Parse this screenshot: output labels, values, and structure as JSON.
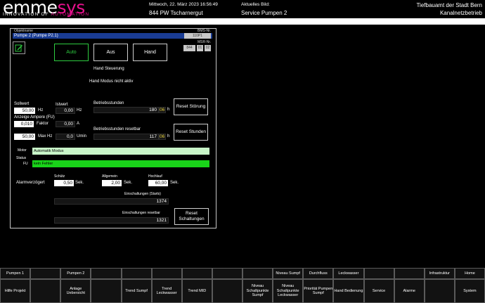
{
  "header": {
    "logo_main_black": "emme",
    "logo_main_pink": "sys",
    "logo_sub_a": "INNOVATION OF ",
    "logo_sub_b": "AUTOMATION",
    "datetime": "Mittwoch, 22. März 2023 16:56:49",
    "station": "844 PW Tscharnergut",
    "current_view_label": "Aktuelles Bild:",
    "current_view": "Service Pumpen 2",
    "org_line1": "Tiefbauamt der Stadt Bern",
    "org_line2": "Kanalnetzbetrieb"
  },
  "panel": {
    "obj_label": "Objektname",
    "obj_name": "Pumpe 2 (Pumpe P2.1)",
    "obj_id_label": "BMS-Nr.",
    "obj_id": "110P1",
    "msr_label": "MSR-Nr.",
    "msr_values": [
      "844",
      "01",
      "02"
    ],
    "modes": {
      "auto": "Auto",
      "aus": "Aus",
      "hand": "Hand"
    },
    "hand_steuerung": "Hand Steuerung",
    "hand_modus": "Hand Modus nicht aktiv",
    "sollwert_label": "Sollwert",
    "sollwert_value": "50,00",
    "sollwert_unit": "Hz",
    "istwert_label": "Istwert",
    "istwert_value": "0,00",
    "istwert_unit": "Hz",
    "ampere_label": "Anzeige Ampere (FU)",
    "faktor_value": "0,010",
    "faktor_label": "Faktor",
    "ampere_value": "0,00",
    "ampere_unit": "A",
    "maxhz_value": "50,00",
    "maxhz_label": "Max Hz",
    "umin_value": "0,0",
    "umin_unit": "Umin",
    "betriebsstunden_label": "Betriebsstunden",
    "betriebsstunden_value": "180",
    "betriebsstunden_min": "06",
    "betriebsstunden_unit": "h",
    "reset_stoerung": "Reset Störung",
    "betriebsstunden_reset_label": "Betriebsstunden resetbar",
    "betriebsstunden_reset_value": "117",
    "betriebsstunden_reset_min": "06",
    "reset_stunden": "Reset Stunden",
    "motor_label": "Motor",
    "motor_value": "Automatik Modus",
    "status_label": "Status",
    "fu_label": "FU",
    "fu_value": "kein Fehler",
    "alarm_label": "Alarmverzögert",
    "schuetz_label": "Schütz",
    "schuetz_value": "0,50",
    "schuetz_unit": "Sek.",
    "allgemein_label": "Allgemein",
    "allgemein_value": "2,00",
    "allgemein_unit": "Sek.",
    "hochlauf_label": "Hochlauf",
    "hochlauf_value": "60,00",
    "hochlauf_unit": "Sek.",
    "starts_label": "Einschaltungen (Starts)",
    "starts_value": "1374",
    "starts_reset_label": "Einschaltungen resetbar",
    "starts_reset_value": "1321",
    "reset_schaltungen": "Reset Schaltungen"
  },
  "footer": {
    "row1": [
      "Pumpen 1",
      "",
      "Pumpen 2",
      "",
      "",
      "",
      "",
      "",
      "",
      "Niveau Sumpf",
      "Durchfluss",
      "Leckwasser",
      "",
      "",
      "Infrastruktur",
      "Home"
    ],
    "row2": [
      "Hilfe Projekt",
      "",
      "Anlage Uebersicht",
      "",
      "Trend Sumpf",
      "Trend Leckwasser",
      "Trend MID",
      "",
      "Niveau Schaltpunkte Sumpf",
      "Niveau Schaltpunkte Leckwasser",
      "Priorität Pumpen Sumpf",
      "Hand Bedienung",
      "Service",
      "Alarme",
      "",
      "System"
    ]
  },
  "colors": {
    "motor_bar": "#c8f5c8",
    "fu_bar": "#19d419",
    "active_mode": "#2ecc40",
    "brand_pink": "#e8118e",
    "object_field": "#1a3c94"
  }
}
